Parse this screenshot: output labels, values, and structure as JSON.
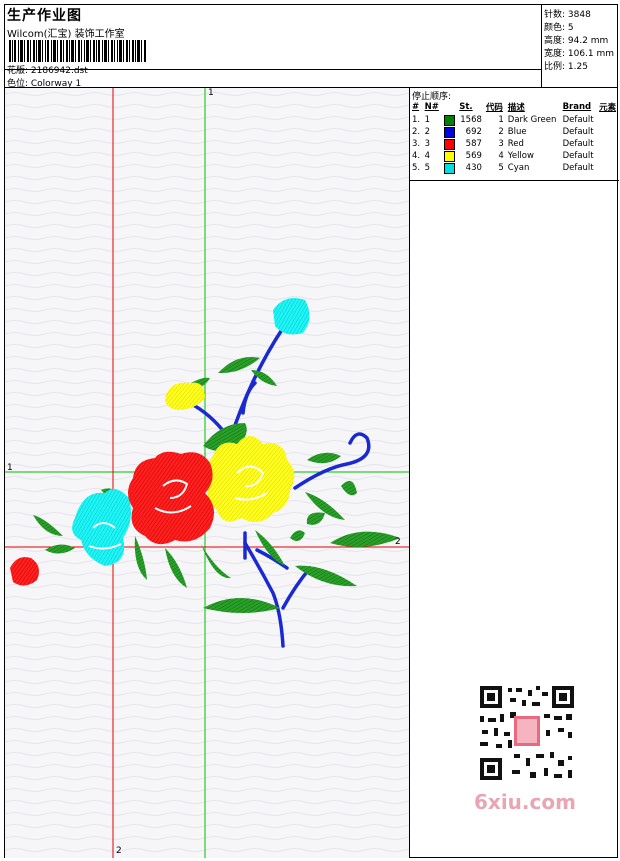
{
  "header": {
    "title": "生产作业图",
    "subtitle": "Wilcom(汇宝) 装饰工作室",
    "design_label": "花版: 2186942.dst",
    "colorway_label": "色位: Colorway 1"
  },
  "stats": {
    "stitches": "针数: 3848",
    "colors": "颜色: 5",
    "height": "高度: 94.2 mm",
    "width": "宽度: 106.1 mm",
    "scale": "比例: 1.25"
  },
  "stop_sequence": {
    "title": "停止顺序:",
    "columns": [
      "#",
      "N#",
      "St.",
      "代码",
      "描述",
      "Brand",
      "元素"
    ],
    "rows": [
      {
        "idx": "1.",
        "n": "1",
        "color": "#008000",
        "st": "1568",
        "code": "1",
        "desc": "Dark Green",
        "brand": "Default"
      },
      {
        "idx": "2.",
        "n": "2",
        "color": "#0000e0",
        "st": "692",
        "code": "2",
        "desc": "Blue",
        "brand": "Default"
      },
      {
        "idx": "3.",
        "n": "3",
        "color": "#ff0000",
        "st": "587",
        "code": "3",
        "desc": "Red",
        "brand": "Default"
      },
      {
        "idx": "4.",
        "n": "4",
        "color": "#ffff00",
        "st": "569",
        "code": "4",
        "desc": "Yellow",
        "brand": "Default"
      },
      {
        "idx": "5.",
        "n": "5",
        "color": "#00e0e0",
        "st": "430",
        "code": "5",
        "desc": "Cyan",
        "brand": "Default"
      }
    ]
  },
  "axes": {
    "green_top": "1",
    "green_left": "1",
    "red_right": "2",
    "red_bottom": "2"
  },
  "watermark": "6xiu.com",
  "colors": {
    "green_axis": "#00c000",
    "red_axis": "#e00000",
    "thread_green": "#1a9a1a",
    "thread_blue": "#1a2ad0",
    "thread_red": "#ff1a1a",
    "thread_yellow": "#ffff10",
    "thread_cyan": "#10f0f0"
  }
}
